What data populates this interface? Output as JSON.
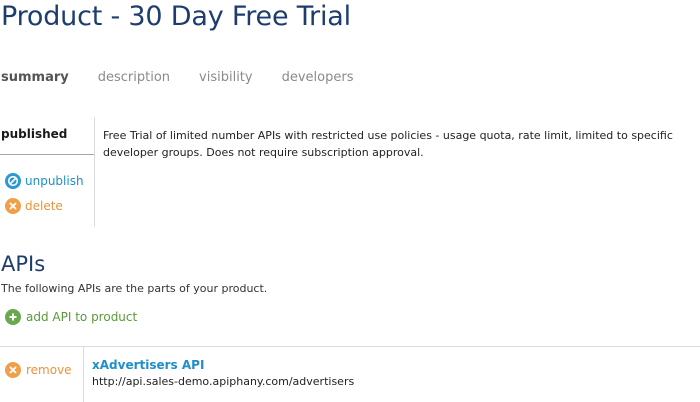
{
  "page": {
    "title": "Product - 30 Day Free Trial"
  },
  "tabs": [
    {
      "label": "summary",
      "active": true
    },
    {
      "label": "description",
      "active": false
    },
    {
      "label": "visibility",
      "active": false
    },
    {
      "label": "developers",
      "active": false
    }
  ],
  "status_panel": {
    "status": "published",
    "actions": {
      "unpublish": {
        "label": "unpublish",
        "icon": "unpublish-icon",
        "color": "#2a98d3"
      },
      "delete": {
        "label": "delete",
        "icon": "close-circle-icon",
        "color": "#f0a04a"
      }
    },
    "description": "Free Trial of limited number APIs with restricted use policies - usage quota, rate limit, limited to specific developer groups. Does not require subscription approval."
  },
  "apis": {
    "heading": "APIs",
    "subtitle": "The following APIs are the parts of your product.",
    "add_label": "add API to product",
    "add_icon": "plus-circle-icon",
    "rows": [
      {
        "remove_label": "remove",
        "name": "xAdvertisers API",
        "url": "http://api.sales-demo.apiphany.com/advertisers"
      }
    ]
  },
  "colors": {
    "title": "#1d3d6e",
    "link_blue": "#1f8fc7",
    "action_orange": "#e8943a",
    "action_green": "#5a9a3a"
  }
}
